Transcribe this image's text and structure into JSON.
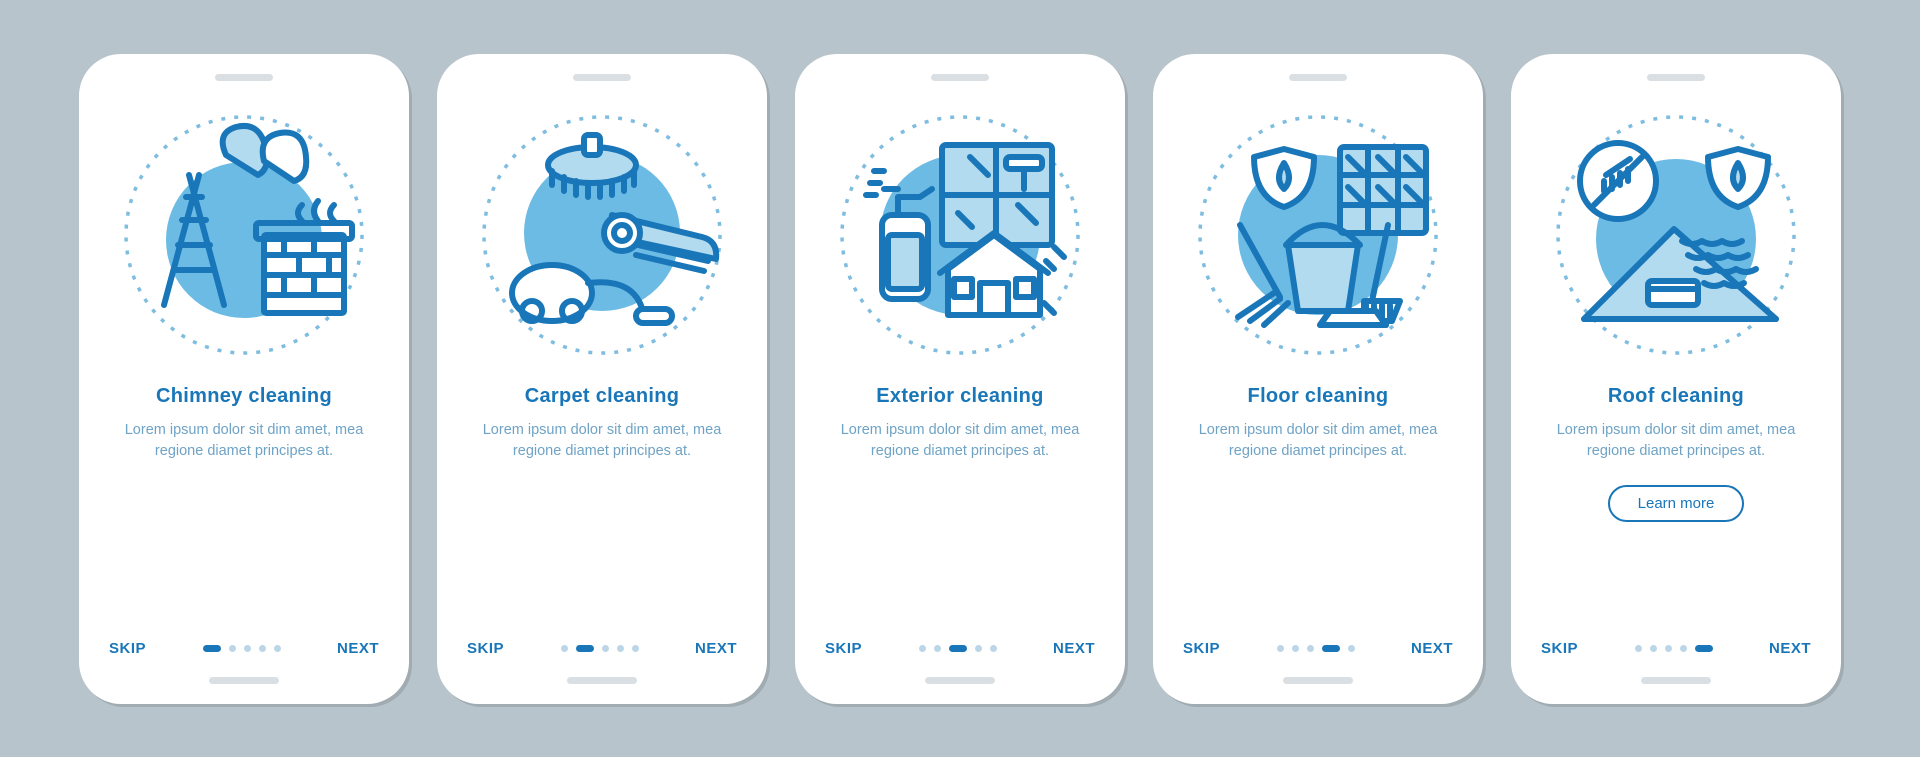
{
  "common": {
    "skip": "SKIP",
    "next": "NEXT",
    "learn_more": "Learn more",
    "description": "Lorem ipsum dolor sit dim amet, mea regione diamet principes at."
  },
  "screens": [
    {
      "title": "Chimney cleaning",
      "icon": "chimney-cleaning-icon",
      "active_dot": 0,
      "has_learn_more": false
    },
    {
      "title": "Carpet cleaning",
      "icon": "carpet-cleaning-icon",
      "active_dot": 1,
      "has_learn_more": false
    },
    {
      "title": "Exterior cleaning",
      "icon": "exterior-cleaning-icon",
      "active_dot": 2,
      "has_learn_more": false
    },
    {
      "title": "Floor cleaning",
      "icon": "floor-cleaning-icon",
      "active_dot": 3,
      "has_learn_more": false
    },
    {
      "title": "Roof cleaning",
      "icon": "roof-cleaning-icon",
      "active_dot": 4,
      "has_learn_more": true
    }
  ],
  "colors": {
    "brand": "#1976b8",
    "muted_text": "#6fa3c6",
    "background": "#b8c4cb",
    "illus_light": "#b2dbef",
    "illus_mid": "#6cbbe4"
  }
}
